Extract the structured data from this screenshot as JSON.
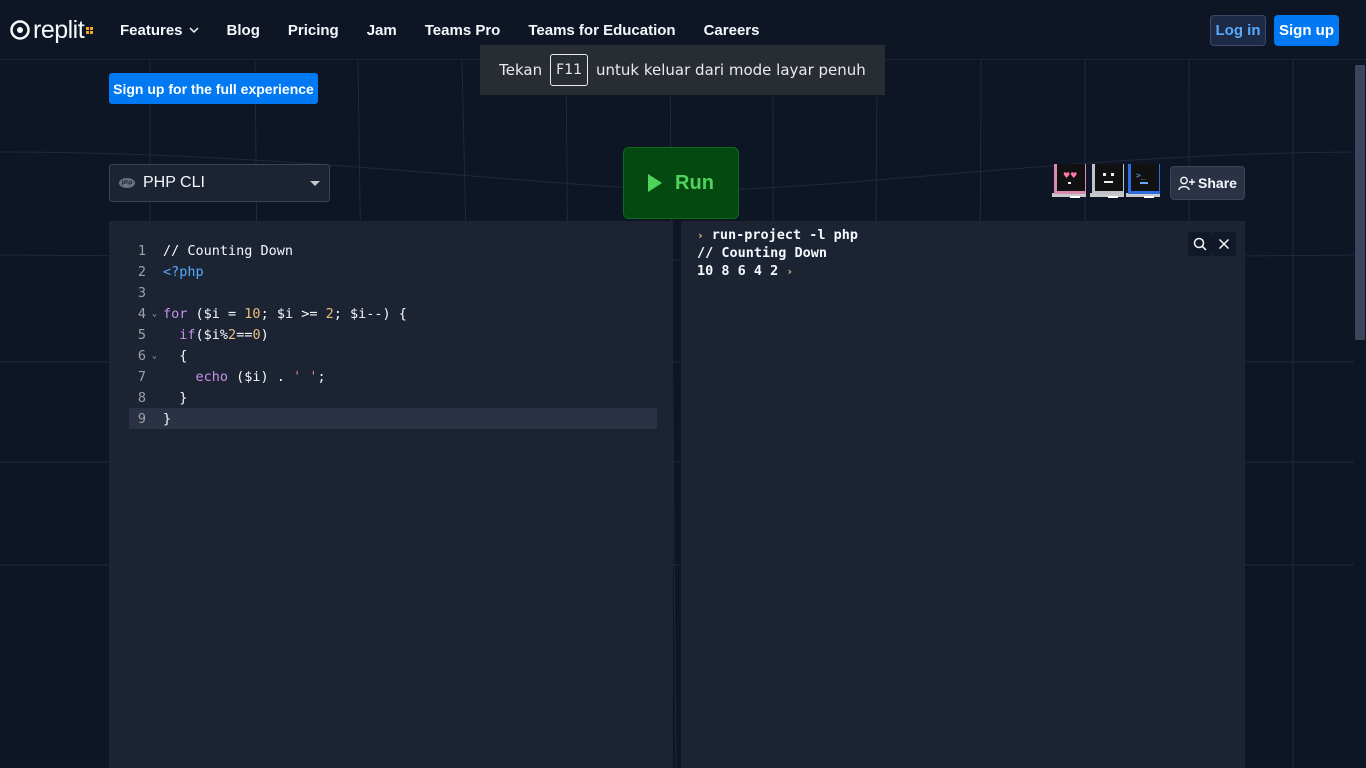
{
  "nav": {
    "logo_text": "replit",
    "links": [
      {
        "label": "Features"
      },
      {
        "label": "Blog"
      },
      {
        "label": "Pricing"
      },
      {
        "label": "Jam"
      },
      {
        "label": "Teams Pro"
      },
      {
        "label": "Teams for Education"
      },
      {
        "label": "Careers"
      }
    ],
    "login_label": "Log in",
    "signup_label": "Sign up"
  },
  "toast": {
    "prefix": "Tekan",
    "key": "F11",
    "suffix": "untuk keluar dari mode layar penuh"
  },
  "banner": {
    "signup_full_label": "Sign up for the full experience"
  },
  "toolbar": {
    "language": "PHP CLI",
    "language_icon_text": "php",
    "run_label": "Run",
    "share_label": "Share",
    "avatars": [
      "heart-eyes-bot-icon",
      "neutral-face-bot-icon",
      "terminal-bot-icon"
    ]
  },
  "editor": {
    "lines": [
      {
        "num": "1",
        "fold": "",
        "text": "// Counting Down"
      },
      {
        "num": "2",
        "fold": "",
        "text": "<?php"
      },
      {
        "num": "3",
        "fold": "",
        "text": ""
      },
      {
        "num": "4",
        "fold": "⌄",
        "text": "for ($i = 10; $i >= 2; $i--) {"
      },
      {
        "num": "5",
        "fold": "",
        "text": "  if($i%2==0)"
      },
      {
        "num": "6",
        "fold": "⌄",
        "text": "  {"
      },
      {
        "num": "7",
        "fold": "",
        "text": "    echo ($i) . ' ';"
      },
      {
        "num": "8",
        "fold": "",
        "text": "  }"
      },
      {
        "num": "9",
        "fold": "",
        "text": "}"
      }
    ],
    "active_line": 9
  },
  "console": {
    "command": "run-project -l php",
    "output_line1": "// Counting Down",
    "output_line2": "10 8 6 4 2",
    "prompt_glyph": "›"
  },
  "colors": {
    "background": "#0e1525",
    "panel": "#1c2333",
    "accent_blue": "#0079f2",
    "run_green": "#4ed45c",
    "run_bg": "#044a10"
  }
}
